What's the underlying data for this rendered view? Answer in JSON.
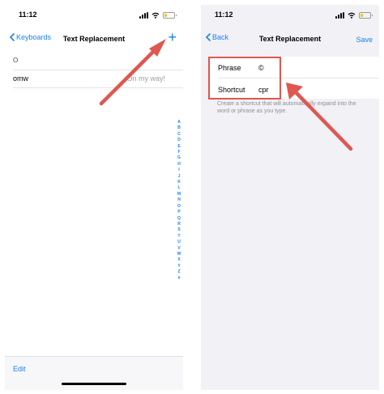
{
  "left_screen": {
    "status_time": "11:12",
    "nav": {
      "back_label": "Keyboards",
      "title": "Text Replacement",
      "add_symbol": "+"
    },
    "section_header": "O",
    "entries": [
      {
        "shortcut": "omw",
        "phrase": "On my way!"
      }
    ],
    "alphabet_index": [
      "A",
      "B",
      "C",
      "D",
      "E",
      "F",
      "G",
      "H",
      "I",
      "J",
      "K",
      "L",
      "M",
      "N",
      "O",
      "P",
      "Q",
      "R",
      "S",
      "T",
      "U",
      "V",
      "W",
      "X",
      "Y",
      "Z",
      "#"
    ],
    "toolbar": {
      "edit_label": "Edit"
    }
  },
  "right_screen": {
    "status_time": "11:12",
    "nav": {
      "back_label": "Back",
      "title": "Text Replacement",
      "save_label": "Save"
    },
    "form": {
      "phrase_label": "Phrase",
      "phrase_value": "©",
      "shortcut_label": "Shortcut",
      "shortcut_value": "cpr"
    },
    "hint": "Create a shortcut that will automatically expand into the word or phrase as you type."
  },
  "annotations": {
    "arrow_color": "#df5750",
    "accent": "#1a80f0"
  }
}
